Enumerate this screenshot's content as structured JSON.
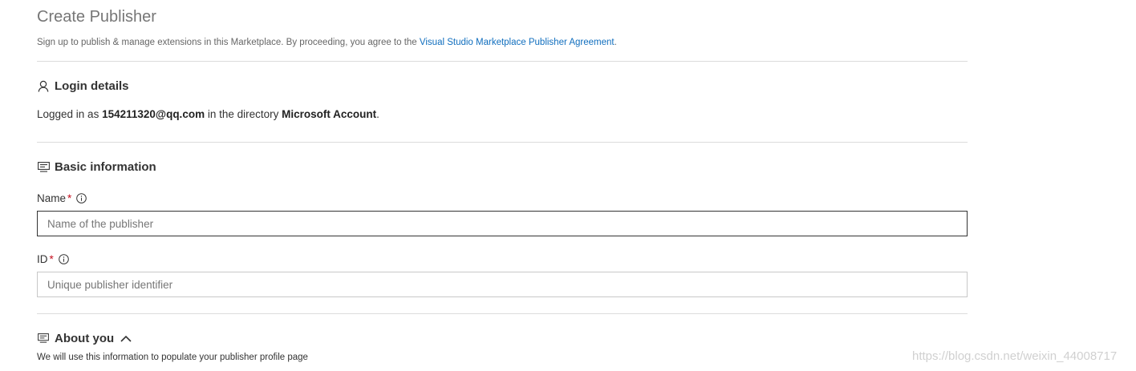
{
  "header": {
    "title": "Create Publisher",
    "subtitle_prefix": "Sign up to publish & manage extensions in this Marketplace. By proceeding, you agree to the ",
    "agreement_link": "Visual Studio Marketplace Publisher Agreement",
    "subtitle_suffix": "."
  },
  "login": {
    "heading": "Login details",
    "icon": "person-icon",
    "text_prefix": "Logged in as ",
    "email": "154211320@qq.com",
    "text_middle": " in the directory ",
    "directory": "Microsoft Account",
    "text_suffix": "."
  },
  "basic": {
    "heading": "Basic information",
    "icon": "form-icon",
    "name_label": "Name",
    "name_required": "*",
    "name_placeholder": "Name of the publisher",
    "id_label": "ID",
    "id_required": "*",
    "id_placeholder": "Unique publisher identifier"
  },
  "about": {
    "heading": "About you",
    "icon": "form-icon",
    "toggle_icon": "chevron-up-icon",
    "subtext": "We will use this information to populate your publisher profile page"
  },
  "watermark": "https://blog.csdn.net/weixin_44008717",
  "colors": {
    "link": "#106ebe",
    "required": "#c50f1f",
    "divider": "#dcdcdc"
  }
}
